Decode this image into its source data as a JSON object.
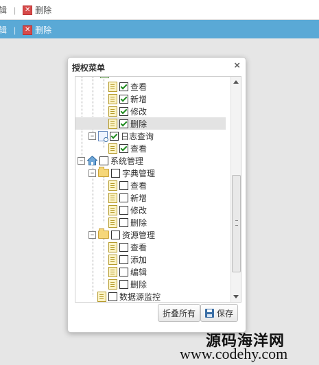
{
  "toolbar": {
    "partial_label": "辑",
    "delete_label": "删除"
  },
  "dialog": {
    "title": "授权菜单",
    "close_glyph": "×",
    "collapse_label": "折叠所有",
    "save_label": "保存"
  },
  "tree": {
    "view": "查看",
    "add": "新增",
    "modify": "修改",
    "delete": "删除",
    "log_query": "日志查询",
    "system": "系统管理",
    "dict": "字典管理",
    "resource": "资源管理",
    "add2": "添加",
    "edit": "编辑",
    "datasource": "数据源监控"
  },
  "watermark": {
    "line1": "源码海洋网",
    "line2": "www.codehy.com"
  }
}
